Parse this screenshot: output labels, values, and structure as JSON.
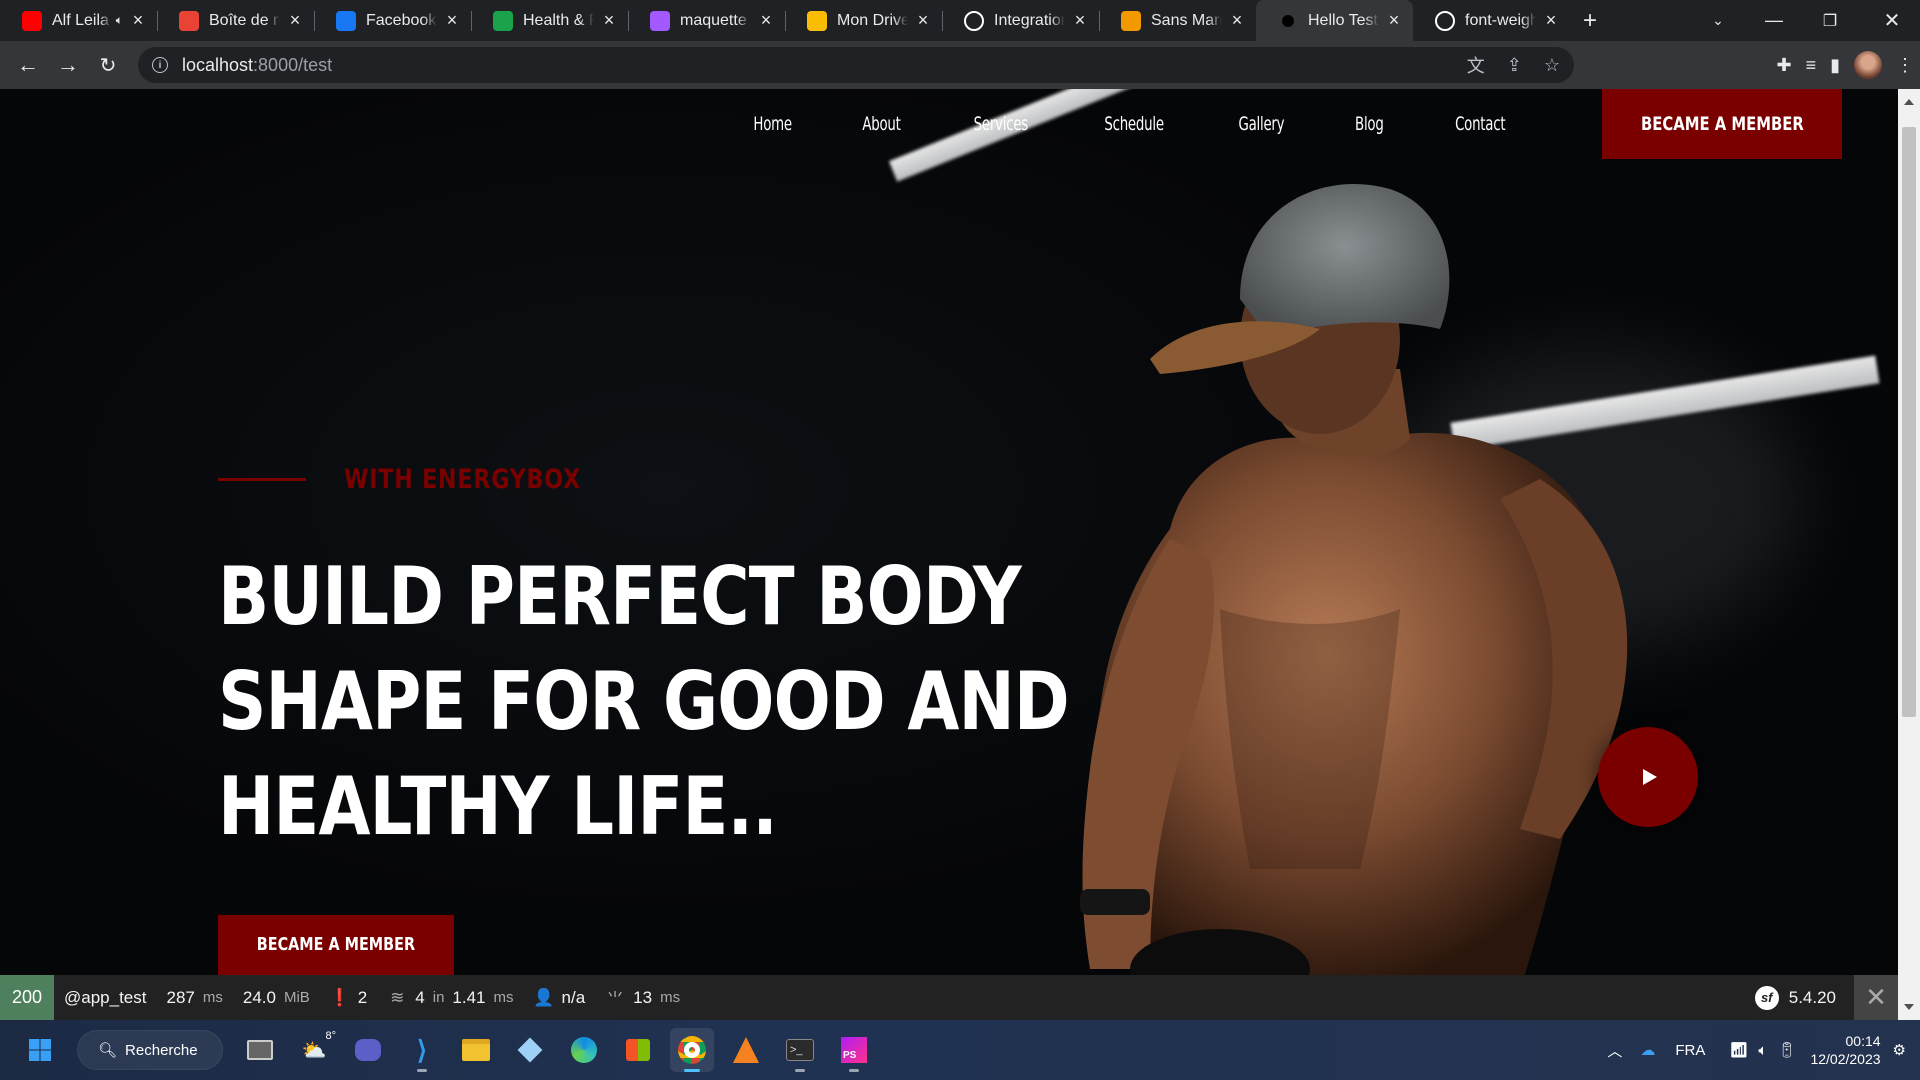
{
  "browser": {
    "tabs": [
      {
        "title": "Alf Leila",
        "favicon": "youtube-icon",
        "color": "#ff0000",
        "muted": true
      },
      {
        "title": "Boîte de réception",
        "favicon": "gmail-icon",
        "color": "#ea4335"
      },
      {
        "title": "Facebook",
        "favicon": "facebook-icon",
        "color": "#1877f2"
      },
      {
        "title": "Health & Fitness",
        "favicon": "check-icon",
        "color": "#1aa34a"
      },
      {
        "title": "maquette web",
        "favicon": "figma-icon",
        "color": "#a259ff"
      },
      {
        "title": "Mon Drive",
        "favicon": "drive-icon",
        "color": "#fbbc04"
      },
      {
        "title": "IntegrationProject",
        "favicon": "github-icon",
        "color": "#ffffff"
      },
      {
        "title": "Sans Marque",
        "favicon": "star-icon",
        "color": "#f29900"
      },
      {
        "title": "Hello TestController",
        "favicon": "dot-icon",
        "color": "#000000",
        "active": true
      },
      {
        "title": "font-weight",
        "favicon": "mdn-icon",
        "color": "#ffffff"
      }
    ],
    "url_host": "localhost",
    "url_rest": ":8000/test"
  },
  "site": {
    "nav": [
      "Home",
      "About",
      "Services",
      "Schedule",
      "Gallery",
      "Blog",
      "Contact"
    ],
    "nav_cta": "BECAME A MEMBER",
    "kicker": "WITH ENERGYBOX",
    "headline": [
      "BUILD PERFECT BODY",
      "SHAPE FOR GOOD AND",
      "HEALTHY LIFE.."
    ],
    "hero_cta": "BECAME A MEMBER",
    "accent_color": "#7a0000"
  },
  "debug_toolbar": {
    "status": "200",
    "route": "@app_test",
    "time_value": "287",
    "time_unit": "ms",
    "memory_value": "24.0",
    "memory_unit": "MiB",
    "logs": "2",
    "cache_value": "4",
    "cache_in": "in",
    "cache_time": "1.41",
    "cache_unit": "ms",
    "user": "n/a",
    "twig_value": "13",
    "twig_unit": "ms",
    "version": "5.4.20"
  },
  "taskbar": {
    "search_label": "Recherche",
    "weather": "8°",
    "language": "FRA",
    "time": "00:14",
    "date": "12/02/2023"
  }
}
